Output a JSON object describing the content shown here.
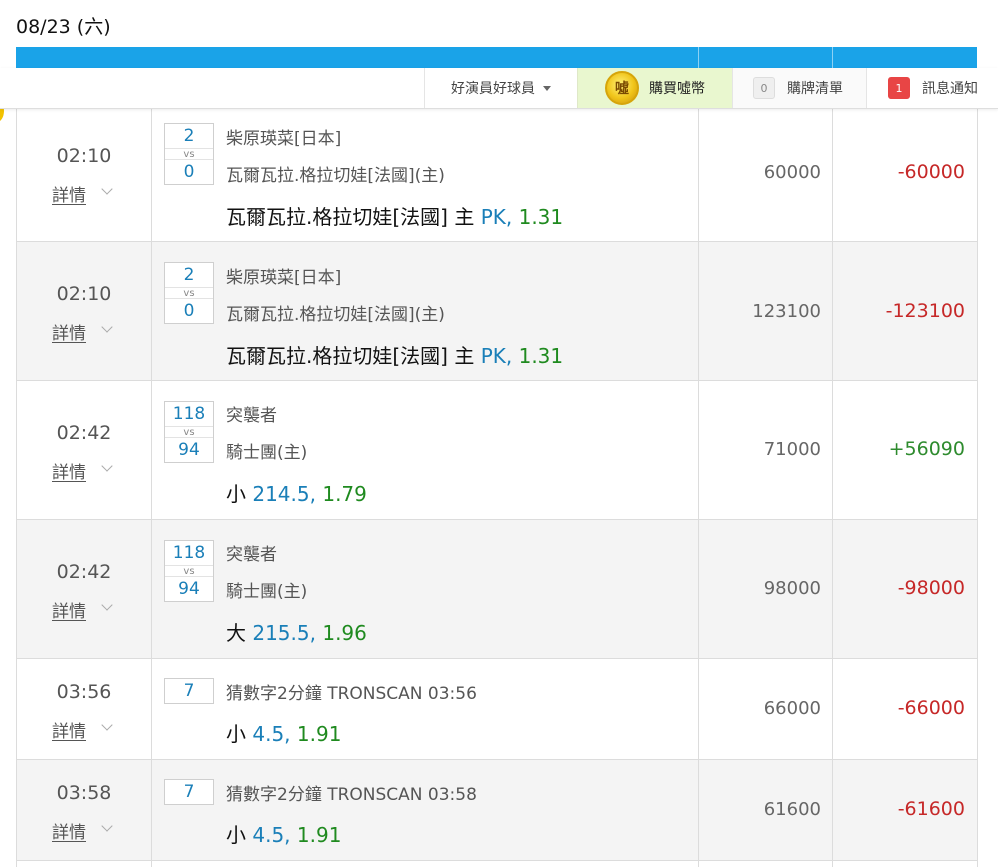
{
  "date": "08/23 (六)",
  "nav": {
    "user_name": "好演員好球員",
    "buy_coin_label": "購買噓幣",
    "coin_glyph": "噓",
    "cart_count": "0",
    "cart_label": "購牌清單",
    "msg_count": "1",
    "msg_label": "訊息通知"
  },
  "detail_label": "詳情",
  "rows": [
    {
      "time": "02:10",
      "score_a": "2",
      "vs": "vs",
      "score_b": "0",
      "team_a": "柴原瑛菜[日本]",
      "team_b": "瓦爾瓦拉.格拉切娃[法國](主)",
      "bet_pick": "瓦爾瓦拉.格拉切娃[法國] 主 ",
      "bet_line": "PK,",
      "bet_odds": " 1.31",
      "stake": "60000",
      "result": "-60000"
    },
    {
      "time": "02:10",
      "score_a": "2",
      "vs": "vs",
      "score_b": "0",
      "team_a": "柴原瑛菜[日本]",
      "team_b": "瓦爾瓦拉.格拉切娃[法國](主)",
      "bet_pick": "瓦爾瓦拉.格拉切娃[法國] 主 ",
      "bet_line": "PK,",
      "bet_odds": " 1.31",
      "stake": "123100",
      "result": "-123100"
    },
    {
      "time": "02:42",
      "score_a": "118",
      "vs": "vs",
      "score_b": "94",
      "team_a": "突襲者",
      "team_b": "騎士團(主)",
      "bet_pick": "小 ",
      "bet_line": "214.5,",
      "bet_odds": " 1.79",
      "stake": "71000",
      "result": "+56090"
    },
    {
      "time": "02:42",
      "score_a": "118",
      "vs": "vs",
      "score_b": "94",
      "team_a": "突襲者",
      "team_b": "騎士團(主)",
      "bet_pick": "大 ",
      "bet_line": "215.5,",
      "bet_odds": " 1.96",
      "stake": "98000",
      "result": "-98000"
    },
    {
      "time": "03:56",
      "score_a": "7",
      "team_a": "猜數字2分鐘 TRONSCAN 03:56",
      "bet_pick": "小 ",
      "bet_line": "4.5,",
      "bet_odds": " 1.91",
      "stake": "66000",
      "result": "-66000"
    },
    {
      "time": "03:58",
      "score_a": "7",
      "team_a": "猜數字2分鐘 TRONSCAN 03:58",
      "bet_pick": "小 ",
      "bet_line": "4.5,",
      "bet_odds": " 1.91",
      "stake": "61600",
      "result": "-61600"
    }
  ]
}
